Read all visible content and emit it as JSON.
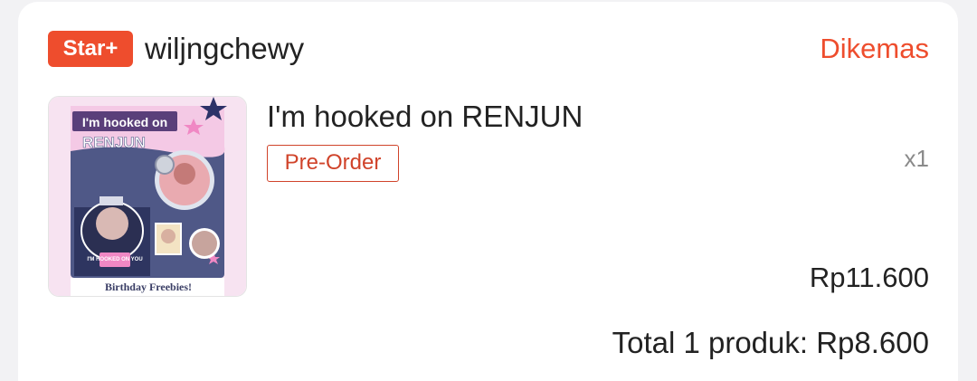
{
  "shop": {
    "badge": "Star+",
    "name": "wiljngchewy",
    "status": "Dikemas"
  },
  "product": {
    "title": "I'm hooked on RENJUN",
    "tag": "Pre-Order",
    "quantity": "x1",
    "price": "Rp11.600",
    "image": {
      "headline_1": "I'm hooked on",
      "headline_2": "RENJUN",
      "footer": "Birthday Freebies!",
      "sticker": "I'M HOOKED ON YOU"
    }
  },
  "order": {
    "total": "Total 1 produk: Rp8.600"
  },
  "colors": {
    "accent": "#ee4d2d",
    "preorder": "#d0432a",
    "text": "#222222",
    "muted": "#8a8a8a"
  }
}
